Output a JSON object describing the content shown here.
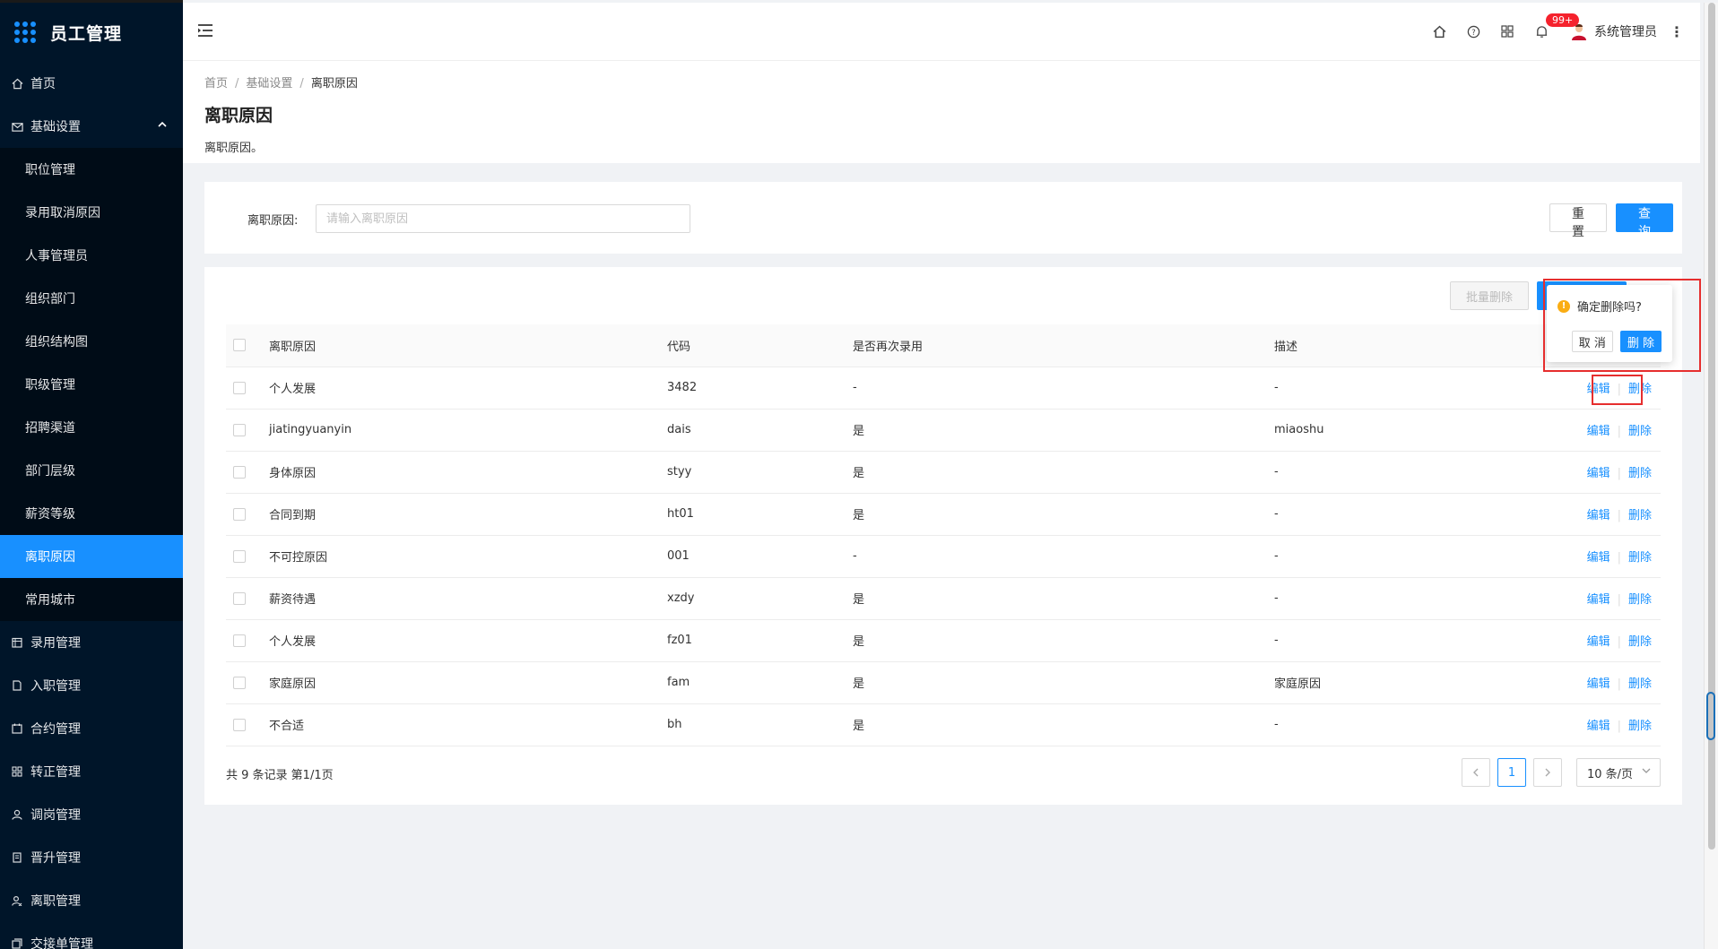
{
  "app": {
    "title": "员工管理"
  },
  "sidebar": {
    "home": "首页",
    "group": "基础设置",
    "sub_items": [
      {
        "label": "职位管理"
      },
      {
        "label": "录用取消原因"
      },
      {
        "label": "人事管理员"
      },
      {
        "label": "组织部门"
      },
      {
        "label": "组织结构图"
      },
      {
        "label": "职级管理"
      },
      {
        "label": "招聘渠道"
      },
      {
        "label": "部门层级"
      },
      {
        "label": "薪资等级"
      },
      {
        "label": "离职原因",
        "active": true
      },
      {
        "label": "常用城市"
      }
    ],
    "items": [
      {
        "label": "录用管理",
        "icon": "calendar-icon"
      },
      {
        "label": "入职管理",
        "icon": "file-icon"
      },
      {
        "label": "合约管理",
        "icon": "contract-icon"
      },
      {
        "label": "转正管理",
        "icon": "grid-icon"
      },
      {
        "label": "调岗管理",
        "icon": "user-icon"
      },
      {
        "label": "晋升管理",
        "icon": "document-icon"
      },
      {
        "label": "离职管理",
        "icon": "user-leave-icon"
      },
      {
        "label": "交接单管理",
        "icon": "handover-icon"
      }
    ]
  },
  "header": {
    "notification_badge": "99+",
    "username": "系统管理员"
  },
  "breadcrumb": {
    "root": "首页",
    "parent": "基础设置",
    "current": "离职原因"
  },
  "page": {
    "title": "离职原因",
    "description": "离职原因。"
  },
  "search": {
    "label": "离职原因:",
    "placeholder": "请输入离职原因",
    "reset_label": "重 置",
    "query_label": "查 询"
  },
  "table": {
    "batch_delete_label": "批量删除",
    "columns": [
      "离职原因",
      "代码",
      "是否再次录用",
      "描述"
    ],
    "edit_label": "编辑",
    "delete_label": "删除",
    "rows": [
      {
        "name": "个人发展",
        "code": "3482",
        "rehire": "-",
        "desc": "-"
      },
      {
        "name": "jiatingyuanyin",
        "code": "dais",
        "rehire": "是",
        "desc": "miaoshu"
      },
      {
        "name": "身体原因",
        "code": "styy",
        "rehire": "是",
        "desc": "-"
      },
      {
        "name": "合同到期",
        "code": "ht01",
        "rehire": "是",
        "desc": "-"
      },
      {
        "name": "不可控原因",
        "code": "001",
        "rehire": "-",
        "desc": "-"
      },
      {
        "name": "薪资待遇",
        "code": "xzdy",
        "rehire": "是",
        "desc": "-"
      },
      {
        "name": "个人发展",
        "code": "fz01",
        "rehire": "是",
        "desc": "-"
      },
      {
        "name": "家庭原因",
        "code": "fam",
        "rehire": "是",
        "desc": "家庭原因"
      },
      {
        "name": "不合适",
        "code": "bh",
        "rehire": "是",
        "desc": "-"
      }
    ]
  },
  "pagination": {
    "summary": "共 9 条记录 第1/1页",
    "current_page": "1",
    "page_size": "10 条/页"
  },
  "popconfirm": {
    "message": "确定删除吗?",
    "cancel_label": "取 消",
    "confirm_label": "删 除"
  },
  "colors": {
    "primary": "#1890ff",
    "sidebar_bg": "#001529",
    "annotation": "#e62e2e"
  }
}
